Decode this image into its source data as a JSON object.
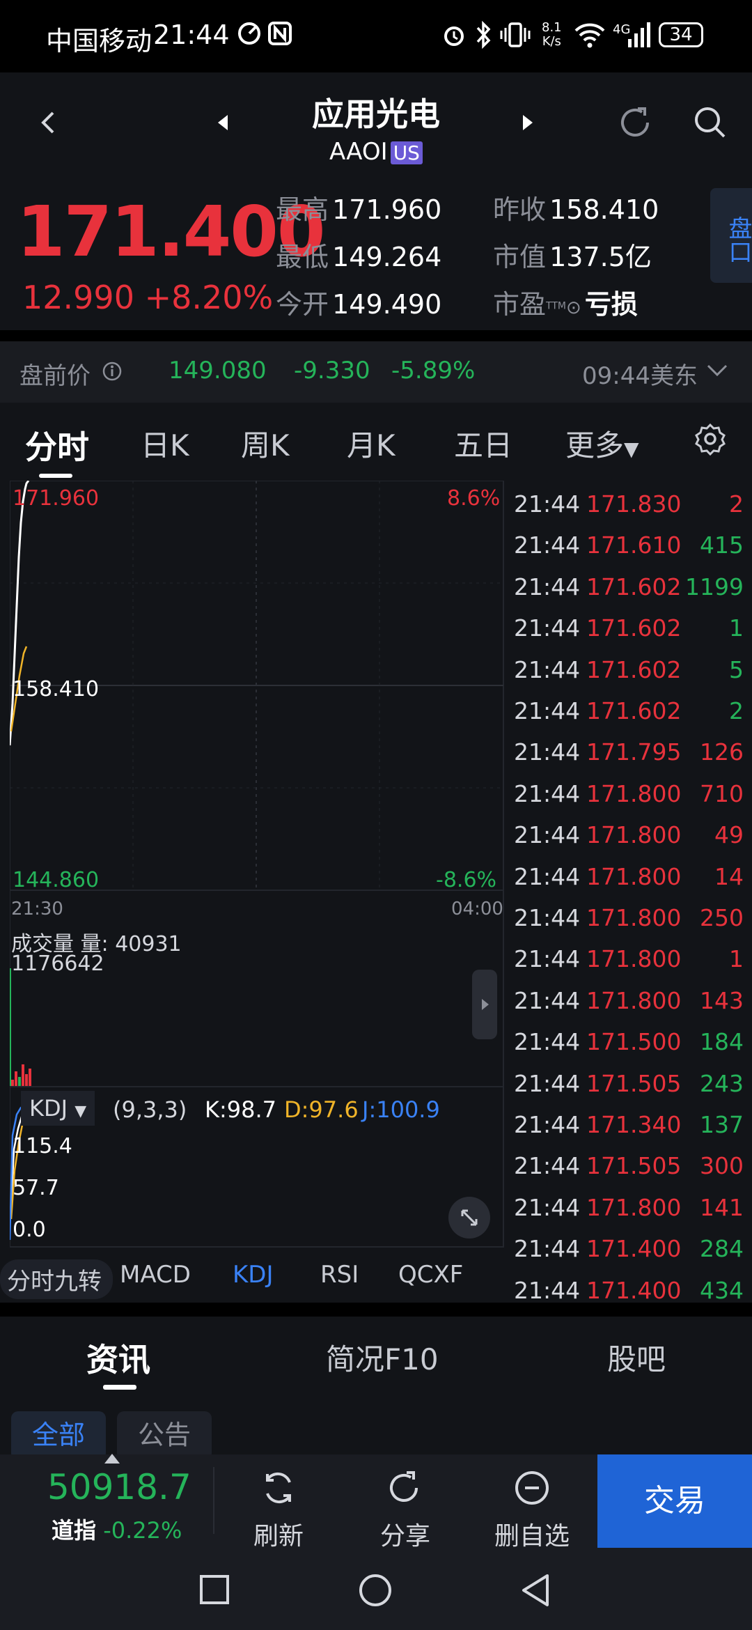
{
  "status_bar": {
    "carrier": "中国移动",
    "time": "21:44",
    "net_speed_top": "8.1",
    "net_speed_bottom": "K/s",
    "network": "4G",
    "battery": "34"
  },
  "header": {
    "name": "应用光电",
    "ticker": "AAOI",
    "market_badge": "US"
  },
  "quote": {
    "price": "171.400",
    "change": "12.990",
    "change_pct": "+8.20%",
    "high_label": "最高",
    "high": "171.960",
    "low_label": "最低",
    "low": "149.264",
    "open_label": "今开",
    "open": "149.490",
    "prev_close_label": "昨收",
    "prev_close": "158.410",
    "market_cap_label": "市值",
    "market_cap": "137.5亿",
    "pe_label": "市盈",
    "pe_sup": "TTM",
    "pe": "亏损",
    "side_tab": "盘口"
  },
  "premarket": {
    "label": "盘前价",
    "price": "149.080",
    "change": "-9.330",
    "change_pct": "-5.89%",
    "time": "09:44美东"
  },
  "tabs": [
    "分时",
    "日K",
    "周K",
    "月K",
    "五日",
    "更多"
  ],
  "chart": {
    "top_price": "171.960",
    "top_pct": "8.6%",
    "mid_price": "158.410",
    "bottom_price": "144.860",
    "bottom_pct": "-8.6%",
    "time_start": "21:30",
    "time_end": "04:00",
    "volume_label": "成交量",
    "volume_qty_label": "量:",
    "volume_qty": "40931",
    "volume_total": "1176642",
    "kdj_label": "KDJ",
    "kdj_params": "(9,3,3)",
    "k_val": "K:98.7",
    "d_val": "D:97.6",
    "j_val": "J:100.9",
    "kdj_levels": [
      "115.4",
      "57.7",
      "0.0"
    ]
  },
  "indicator_tabs": [
    "分时九转",
    "MACD",
    "KDJ",
    "RSI",
    "QCXF"
  ],
  "trades": [
    {
      "time": "21:44",
      "price": "171.830",
      "vol": "2",
      "vcolor": "red"
    },
    {
      "time": "21:44",
      "price": "171.610",
      "vol": "415",
      "vcolor": "green"
    },
    {
      "time": "21:44",
      "price": "171.602",
      "vol": "1199",
      "vcolor": "green"
    },
    {
      "time": "21:44",
      "price": "171.602",
      "vol": "1",
      "vcolor": "green"
    },
    {
      "time": "21:44",
      "price": "171.602",
      "vol": "5",
      "vcolor": "green"
    },
    {
      "time": "21:44",
      "price": "171.602",
      "vol": "2",
      "vcolor": "green"
    },
    {
      "time": "21:44",
      "price": "171.795",
      "vol": "126",
      "vcolor": "red"
    },
    {
      "time": "21:44",
      "price": "171.800",
      "vol": "710",
      "vcolor": "red"
    },
    {
      "time": "21:44",
      "price": "171.800",
      "vol": "49",
      "vcolor": "red"
    },
    {
      "time": "21:44",
      "price": "171.800",
      "vol": "14",
      "vcolor": "red"
    },
    {
      "time": "21:44",
      "price": "171.800",
      "vol": "250",
      "vcolor": "red"
    },
    {
      "time": "21:44",
      "price": "171.800",
      "vol": "1",
      "vcolor": "red"
    },
    {
      "time": "21:44",
      "price": "171.800",
      "vol": "143",
      "vcolor": "red"
    },
    {
      "time": "21:44",
      "price": "171.500",
      "vol": "184",
      "vcolor": "green"
    },
    {
      "time": "21:44",
      "price": "171.505",
      "vol": "243",
      "vcolor": "green"
    },
    {
      "time": "21:44",
      "price": "171.340",
      "vol": "137",
      "vcolor": "green"
    },
    {
      "time": "21:44",
      "price": "171.505",
      "vol": "300",
      "vcolor": "red"
    },
    {
      "time": "21:44",
      "price": "171.800",
      "vol": "141",
      "vcolor": "red"
    },
    {
      "time": "21:44",
      "price": "171.400",
      "vol": "284",
      "vcolor": "green"
    },
    {
      "time": "21:44",
      "price": "171.400",
      "vol": "434",
      "vcolor": "green"
    }
  ],
  "info_tabs": [
    "资讯",
    "简况F10",
    "股吧"
  ],
  "sub_tabs": [
    "全部",
    "公告"
  ],
  "bottom_bar": {
    "index_value": "50918.7",
    "index_name": "道指",
    "index_change": "-0.22%",
    "refresh": "刷新",
    "share": "分享",
    "remove": "删自选",
    "trade": "交易"
  },
  "colors": {
    "up": "#e8323c",
    "down": "#25b45a",
    "accent": "#1f64d6"
  }
}
